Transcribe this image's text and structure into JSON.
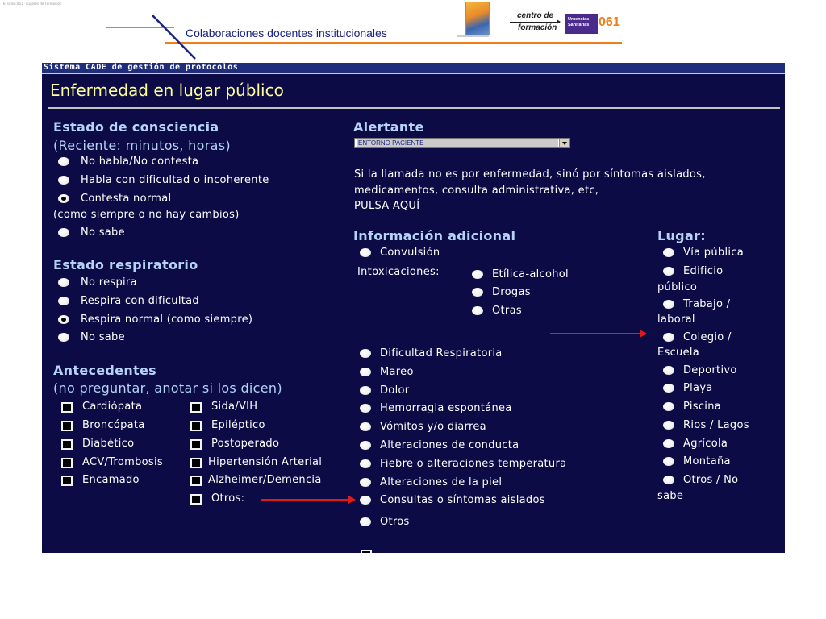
{
  "header": {
    "tiny_text": "El salón 061 · Lugares de Formación",
    "caption": "Colaboraciones docentes institucionales",
    "logo_centro_line1": "centro de",
    "logo_centro_line2": "formación",
    "logo_urgencias_line1": "Urxencias",
    "logo_urgencias_line2": "Sanitarias",
    "logo_061": "061",
    "colors": {
      "orange_line": "#f07d1a",
      "navy_line": "#1a237e"
    }
  },
  "window": {
    "title": "Sistema CADE de gestión de protocolos",
    "page_title": "Enfermedad en lugar público",
    "colors": {
      "background": "#0c0b45",
      "section": "#b5d3f7",
      "title": "#ffff9a",
      "text": "#ffffff"
    }
  },
  "consciencia": {
    "title": "Estado de consciencia",
    "subtitle": "(Reciente: minutos, horas)",
    "options": [
      "No habla/No contesta",
      "Habla con dificultad o incoherente",
      "Contesta normal",
      "No sabe"
    ],
    "note": "(como siempre o no hay cambios)",
    "selected": "Contesta normal"
  },
  "respiratorio": {
    "title": "Estado respiratorio",
    "options": [
      "No respira",
      "Respira con dificultad",
      "Respira normal (como siempre)",
      "No sabe"
    ],
    "selected": "Respira normal (como siempre)"
  },
  "antecedentes": {
    "title": "Antecedentes",
    "subtitle": "(no preguntar, anotar si los dicen)",
    "col1": [
      "Cardiópata",
      "Broncópata",
      "Diabético",
      "ACV/Trombosis",
      "Encamado"
    ],
    "col2": [
      "Sida/VIH",
      "Epiléptico",
      "Postoperado",
      "Hipertensión Arterial",
      "Alzheimer/Demencia",
      "Otros:"
    ]
  },
  "alertante": {
    "title": "Alertante",
    "value": "ENTORNO PACIENTE",
    "message_line1": "Si la llamada no es por enfermedad, sinó por síntomas aislados,",
    "message_line2": "medicamentos, consulta administrativa, etc,",
    "message_line3": "PULSA AQUÍ"
  },
  "info": {
    "title": "Información adicional",
    "convulsion": "Convulsión",
    "intox_label": "Intoxicaciones:",
    "intox_options": [
      "Etílica-alcohol",
      "Drogas",
      "Otras"
    ],
    "options": [
      "Dificultad Respiratoria",
      "Mareo",
      "Dolor",
      "Hemorragia espontánea",
      "Vómitos y/o diarrea",
      "Alteraciones de conducta",
      "Fiebre o alteraciones temperatura",
      "Alteraciones de la piel",
      "Consultas o síntomas aislados",
      "Otros"
    ]
  },
  "lugar": {
    "title": "Lugar:",
    "via_publica": "Vía pública",
    "edificio": "Edificio",
    "edificio_2": "público",
    "trabajo": "Trabajo /",
    "trabajo_2": "laboral",
    "colegio": "Colegio /",
    "colegio_2": "Escuela",
    "options_simple": [
      "Deportivo",
      "Playa",
      "Piscina",
      "Rios / Lagos",
      "Agrícola",
      "Montaña"
    ],
    "otros": "Otros / No",
    "otros_2": "sabe"
  },
  "annotations": {
    "arrow_color": "#e01a1a"
  }
}
